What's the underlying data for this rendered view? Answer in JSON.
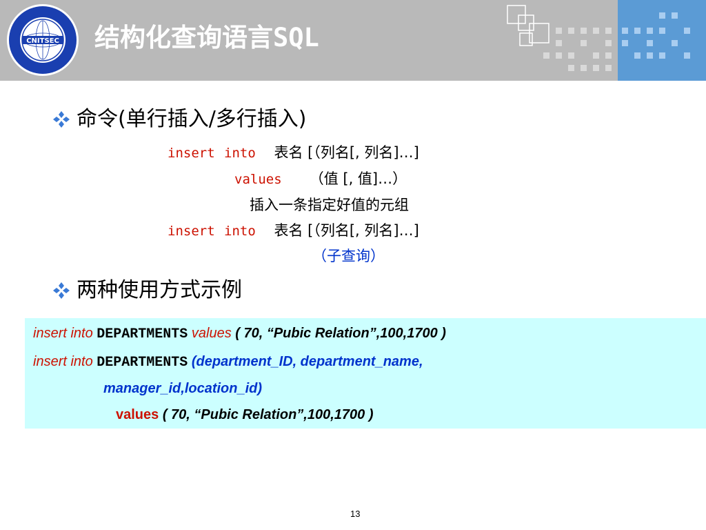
{
  "header": {
    "title_cn": "结构化查询语言",
    "title_en": "SQL",
    "logo_text": "CNITSEC"
  },
  "bullets": [
    {
      "text": "命令(单行插入/多行插入)"
    },
    {
      "text": "两种使用方式示例"
    }
  ],
  "syntax": {
    "line1": {
      "kw1": "insert",
      "kw2": "into",
      "rest": "表名  [（列名[, 列名]…]"
    },
    "line2": {
      "kw": "values",
      "rest": "（值 [, 值]…）"
    },
    "line3": {
      "text": "插入一条指定好值的元组"
    },
    "line4": {
      "kw1": "insert",
      "kw2": "into",
      "rest": "表名  [（列名[, 列名]…]"
    },
    "line5": {
      "text": "（子查询）"
    }
  },
  "examples": {
    "line1": {
      "kw": "insert  into",
      "table": "DEPARTMENTS",
      "values_kw": "values",
      "values": "( 70, “Pubic Relation”,100,1700 )"
    },
    "line2": {
      "kw": "insert  into",
      "table": "DEPARTMENTS",
      "cols": "(department_ID, department_name,"
    },
    "line3": {
      "cols": "manager_id,location_id)"
    },
    "line4": {
      "values_kw": "values",
      "values": "( 70, “Pubic Relation”,100,1700 )"
    }
  },
  "page_number": "13",
  "colors": {
    "header_gray": "#b9b9b9",
    "header_blue": "#5b9bd5",
    "keyword_red": "#cc1100",
    "emphasis_blue": "#0033cc",
    "example_bg": "#ccffff"
  },
  "icons": [
    "logo-seal",
    "diamond-bullet-icon"
  ]
}
